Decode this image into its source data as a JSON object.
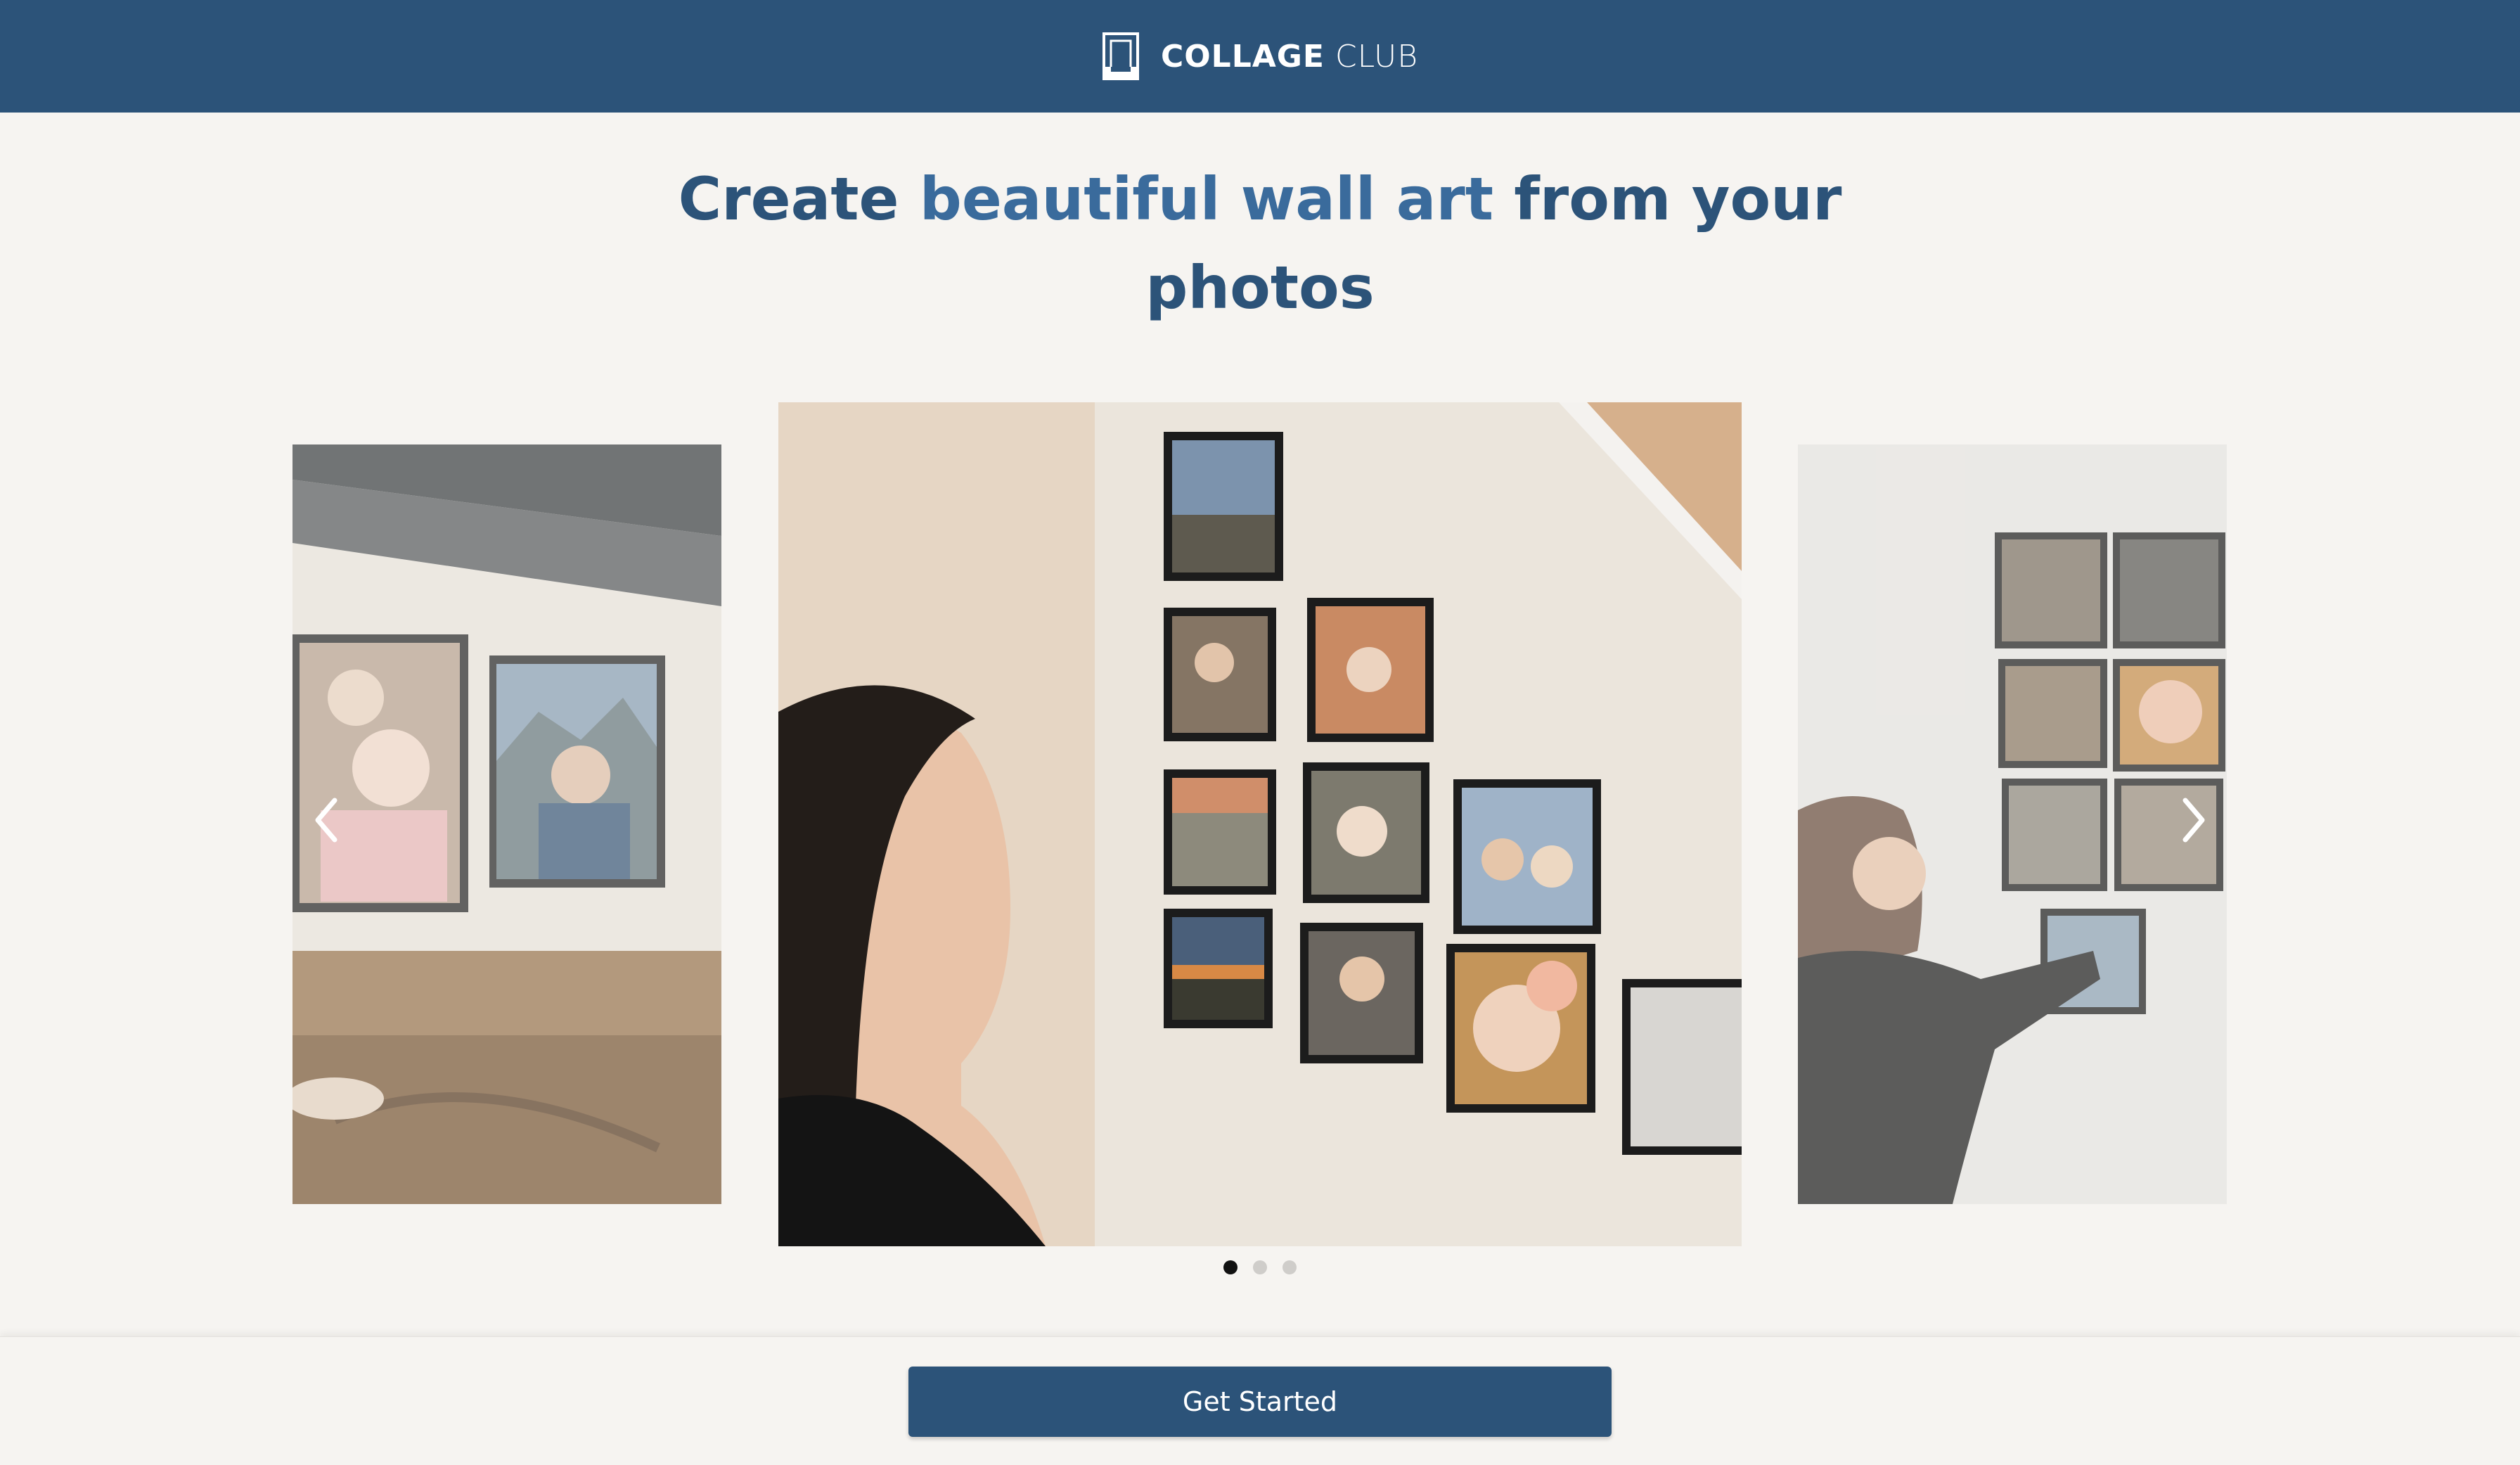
{
  "brand": {
    "name_bold": "COLLAGE",
    "name_light": "CLUB",
    "logo_icon": "frame-logo-icon"
  },
  "headline": {
    "part1": "Create ",
    "accent1": "beautiful",
    "part2": " ",
    "accent2": "wall art",
    "part3": " from your",
    "line2": "photos"
  },
  "carousel": {
    "slides": [
      {
        "label": "framed family photos on shelf"
      },
      {
        "label": "woman viewing photo tile wall on staircase"
      },
      {
        "label": "woman hanging photo tiles on wall"
      }
    ],
    "prev_icon": "chevron-left-icon",
    "next_icon": "chevron-right-icon",
    "active_index": 0,
    "dot_count": 3
  },
  "cta": {
    "label": "Get Started"
  },
  "colors": {
    "brand_navy": "#2c5379",
    "accent_blue": "#3a6b9c",
    "background": "#f6f4f1"
  }
}
